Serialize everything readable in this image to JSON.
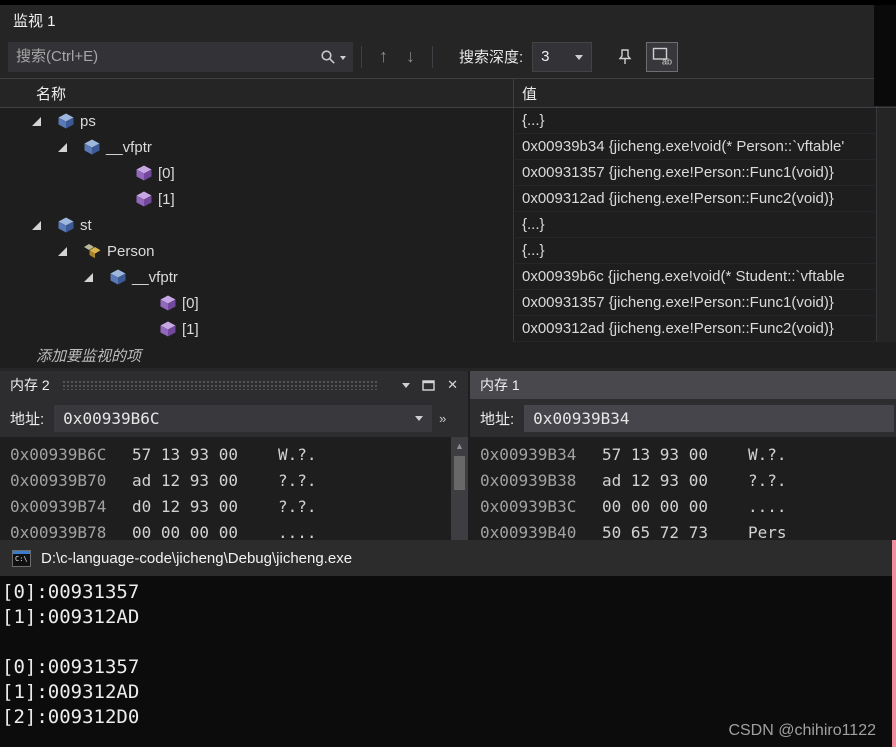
{
  "watch": {
    "title": "监视 1",
    "search": {
      "placeholder": "搜索(Ctrl+E)"
    },
    "toolbar": {
      "depth_label": "搜索深度:",
      "depth_value": "3"
    },
    "columns": {
      "name": "名称",
      "value": "值"
    },
    "rows": [
      {
        "name": "ps",
        "value": "{...}"
      },
      {
        "name": "__vfptr",
        "value": "0x00939b34 {jicheng.exe!void(* Person::`vftable'"
      },
      {
        "name": "[0]",
        "value": "0x00931357 {jicheng.exe!Person::Func1(void)}"
      },
      {
        "name": "[1]",
        "value": "0x009312ad {jicheng.exe!Person::Func2(void)}"
      },
      {
        "name": "st",
        "value": "{...}"
      },
      {
        "name": "Person",
        "value": "{...}"
      },
      {
        "name": "__vfptr",
        "value": "0x00939b6c {jicheng.exe!void(* Student::`vftable"
      },
      {
        "name": "[0]",
        "value": "0x00931357 {jicheng.exe!Person::Func1(void)}"
      },
      {
        "name": "[1]",
        "value": "0x009312ad {jicheng.exe!Person::Func2(void)}"
      }
    ],
    "add_row_label": "添加要监视的项"
  },
  "memory2": {
    "title": "内存 2",
    "address_label": "地址:",
    "address_value": "0x00939B6C",
    "rows": [
      {
        "addr": "0x00939B6C",
        "bytes": "57 13 93 00",
        "ascii": "W.?."
      },
      {
        "addr": "0x00939B70",
        "bytes": "ad 12 93 00",
        "ascii": "?.?."
      },
      {
        "addr": "0x00939B74",
        "bytes": "d0 12 93 00",
        "ascii": "?.?."
      },
      {
        "addr": "0x00939B78",
        "bytes": "00 00 00 00",
        "ascii": "...."
      }
    ]
  },
  "memory1": {
    "title": "内存 1",
    "address_label": "地址:",
    "address_value": "0x00939B34",
    "rows": [
      {
        "addr": "0x00939B34",
        "bytes": "57 13 93 00",
        "ascii": "W.?."
      },
      {
        "addr": "0x00939B38",
        "bytes": "ad 12 93 00",
        "ascii": "?.?."
      },
      {
        "addr": "0x00939B3C",
        "bytes": "00 00 00 00",
        "ascii": "...."
      },
      {
        "addr": "0x00939B40",
        "bytes": "50 65 72 73",
        "ascii": "Pers"
      }
    ]
  },
  "console": {
    "title": "D:\\c-language-code\\jicheng\\Debug\\jicheng.exe",
    "lines": [
      "[0]:00931357",
      "[1]:009312AD",
      "",
      "[0]:00931357",
      "[1]:009312AD",
      "[2]:009312D0"
    ]
  },
  "watermark": "CSDN @chihiro1122",
  "colors": {
    "accent_pink": "#ef8fa0",
    "panel_bg": "#252526",
    "grid_bg": "#1e1e1e"
  }
}
